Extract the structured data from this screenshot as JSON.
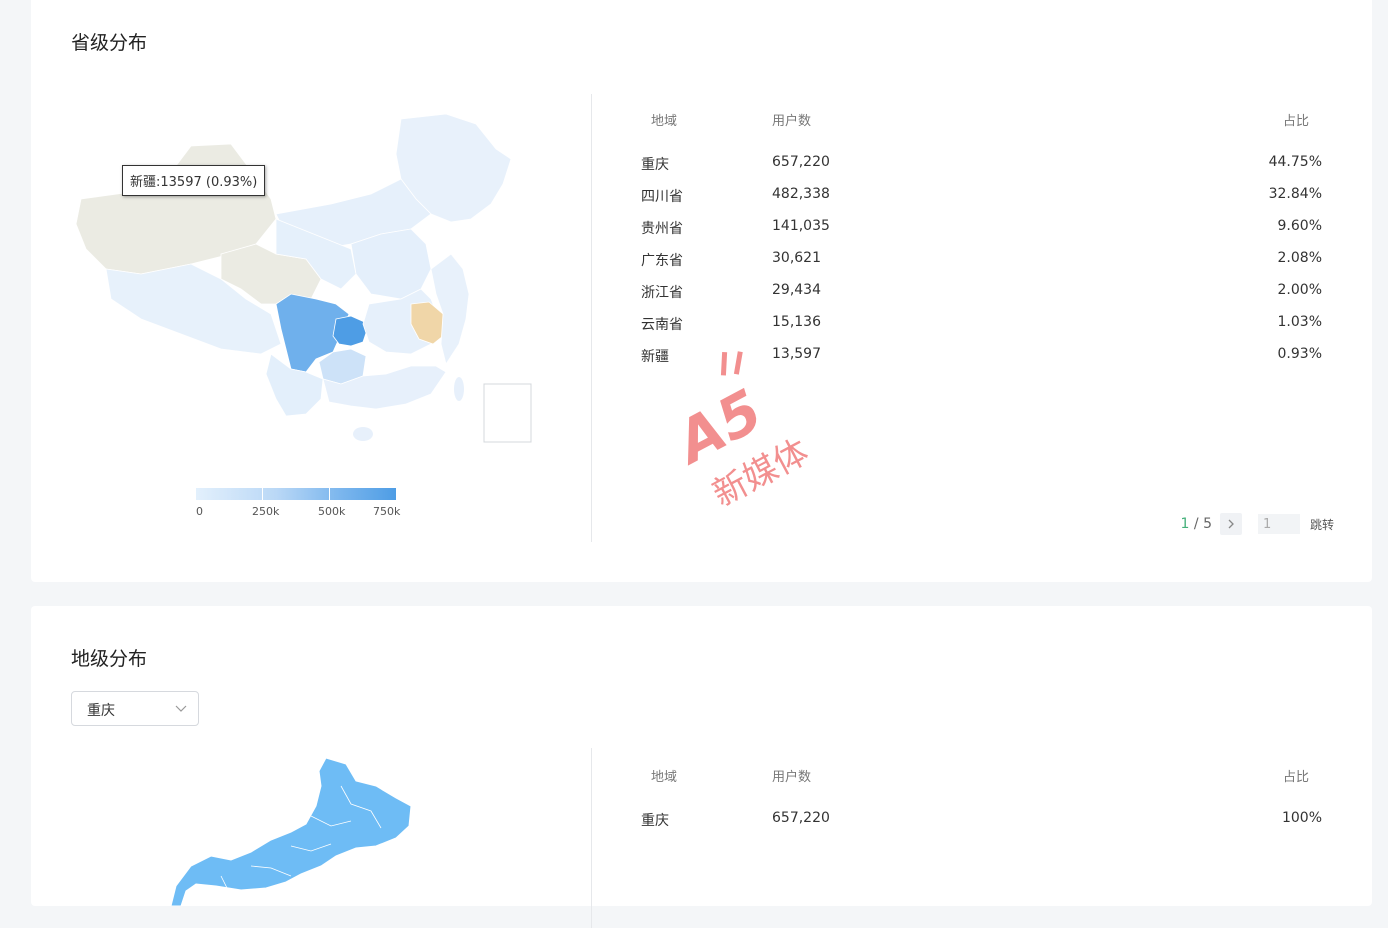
{
  "province": {
    "title": "省级分布",
    "tooltip": "新疆:13597 (0.93%)",
    "legend": {
      "ticks": [
        "0",
        "250k",
        "500k",
        "750k"
      ]
    },
    "table": {
      "headers": {
        "region": "地域",
        "users": "用户数",
        "ratio": "占比"
      },
      "rows": [
        {
          "region": "重庆",
          "users": "657,220",
          "ratio": "44.75%"
        },
        {
          "region": "四川省",
          "users": "482,338",
          "ratio": "32.84%"
        },
        {
          "region": "贵州省",
          "users": "141,035",
          "ratio": "9.60%"
        },
        {
          "region": "广东省",
          "users": "30,621",
          "ratio": "2.08%"
        },
        {
          "region": "浙江省",
          "users": "29,434",
          "ratio": "2.00%"
        },
        {
          "region": "云南省",
          "users": "15,136",
          "ratio": "1.03%"
        },
        {
          "region": "新疆",
          "users": "13,597",
          "ratio": "0.93%"
        }
      ]
    },
    "pagination": {
      "current": "1",
      "total": "5",
      "input_value": "1",
      "jump_label": "跳转"
    }
  },
  "city": {
    "title": "地级分布",
    "select": {
      "value": "重庆"
    },
    "table": {
      "headers": {
        "region": "地域",
        "users": "用户数",
        "ratio": "占比"
      },
      "rows": [
        {
          "region": "重庆",
          "users": "657,220",
          "ratio": "100%"
        }
      ]
    }
  },
  "watermark": {
    "logo": "A5",
    "text": "新媒体"
  },
  "colors": {
    "map_low": "#e6f1fc",
    "map_high": "#4e9de5",
    "highlight": "#f0d6a8",
    "pager_current": "#44b07a",
    "watermark": "#f07c7c"
  }
}
